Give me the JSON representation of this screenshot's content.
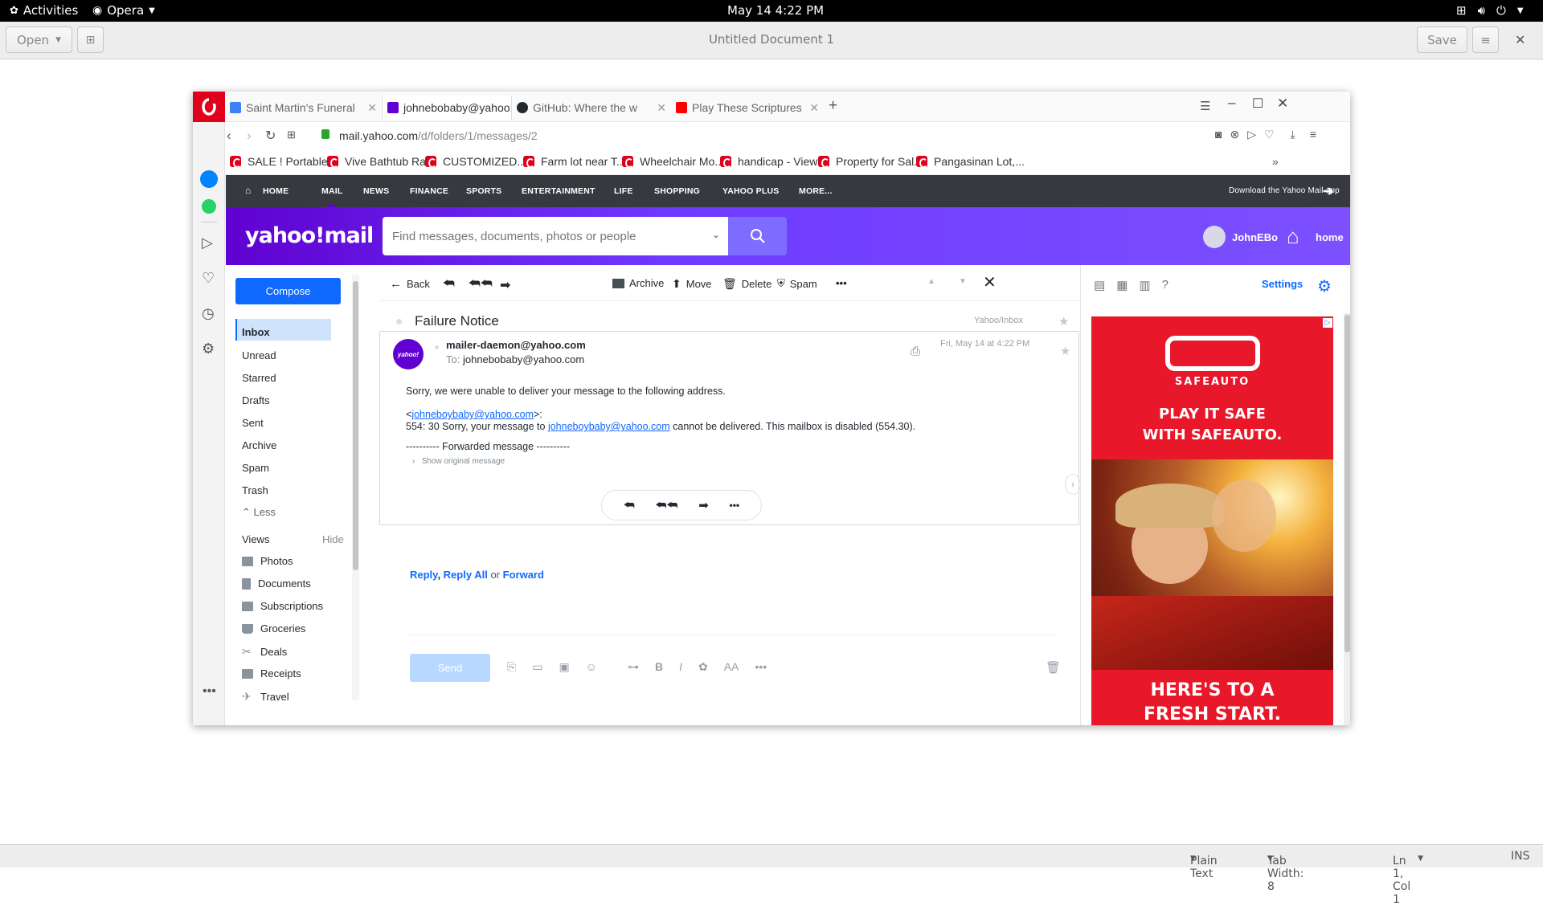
{
  "topbar": {
    "activities": "Activities",
    "app": "Opera",
    "datetime": "May 14  4:22 PM"
  },
  "gedit": {
    "open": "Open",
    "title": "Untitled Document 1",
    "save": "Save",
    "status": {
      "format": "Plain Text",
      "tab_width": "Tab Width: 8",
      "position": "Ln 1, Col 1",
      "mode": "INS"
    }
  },
  "tabs": [
    {
      "label": "Saint Martin's Funeral"
    },
    {
      "label": "johnebobaby@yahoo."
    },
    {
      "label": "GitHub: Where the w"
    },
    {
      "label": "Play These Scriptures"
    }
  ],
  "address": {
    "domain": "mail.yahoo.com",
    "path": "/d/folders/1/messages/2"
  },
  "bookmarks": [
    "SALE ! Portable...",
    "Vive Bathtub Ra...",
    "CUSTOMIZED...",
    "Farm lot near T...",
    "Wheelchair Mo...",
    "handicap - View...",
    "Property for Sal...",
    "Pangasinan Lot,..."
  ],
  "ynav": {
    "items": [
      "HOME",
      "MAIL",
      "NEWS",
      "FINANCE",
      "SPORTS",
      "ENTERTAINMENT",
      "LIFE",
      "SHOPPING",
      "YAHOO PLUS",
      "MORE..."
    ],
    "download": "Download the Yahoo Mail app"
  },
  "yhead": {
    "logo": "yahoo!mail",
    "search_placeholder": "Find messages, documents, photos or people",
    "user": "JohnEBo",
    "home": "home"
  },
  "folders": {
    "compose": "Compose",
    "items": [
      "Inbox",
      "Unread",
      "Starred",
      "Drafts",
      "Sent",
      "Archive",
      "Spam",
      "Trash"
    ],
    "less": "Less",
    "views": "Views",
    "hide": "Hide",
    "view_items": [
      "Photos",
      "Documents",
      "Subscriptions",
      "Groceries",
      "Deals",
      "Receipts",
      "Travel"
    ]
  },
  "toolbar": {
    "back": "Back",
    "archive": "Archive",
    "move": "Move",
    "delete": "Delete",
    "spam": "Spam"
  },
  "message": {
    "subject": "Failure Notice",
    "folder": "Yahoo/Inbox",
    "avatar": "yahoo!",
    "from": "mailer-daemon@yahoo.com",
    "to_label": "To:",
    "to": "johnebobaby@yahoo.com",
    "date": "Fri, May 14 at 4:22 PM",
    "line1": "Sorry, we were unable to deliver your message to the following address.",
    "addr_open": "<",
    "addr": "johneboybaby@yahoo.com",
    "addr_close": ">:",
    "line3a": "554: 30 Sorry, your message to ",
    "line3link": "johneboybaby@yahoo.com",
    "line3b": " cannot be delivered. This mailbox is disabled (554.30).",
    "forwarded": "---------- Forwarded message ----------",
    "show_original": "Show original message"
  },
  "reply": {
    "reply": "Reply",
    "reply_all": "Reply All",
    "or": "or",
    "forward": "Forward",
    "send": "Send"
  },
  "right": {
    "settings": "Settings",
    "ad_brand": "SAFEAUTO",
    "ad_line1": "PLAY IT SAFE",
    "ad_line2": "WITH SAFEAUTO.",
    "ad_line3": "HERE'S TO A",
    "ad_line4": "FRESH START."
  }
}
